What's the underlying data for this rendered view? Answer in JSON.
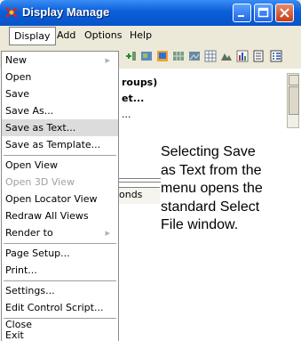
{
  "window": {
    "title": "Display Manage",
    "controls": [
      "minimize",
      "maximize",
      "close"
    ]
  },
  "menubar": {
    "items": [
      "Display",
      "Add",
      "Options",
      "Help"
    ]
  },
  "background_text": {
    "line1": "roups)",
    "line2": "et...",
    "line3": "...",
    "tab": "onds"
  },
  "display_menu": {
    "items": [
      {
        "label": "New",
        "submenu": true,
        "disabled": false
      },
      {
        "label": "Open",
        "disabled": false
      },
      {
        "label": "Save",
        "disabled": false
      },
      {
        "label": "Save As...",
        "disabled": false
      },
      {
        "label": "Save as Text...",
        "disabled": false,
        "selected": true
      },
      {
        "label": "Save as Template...",
        "disabled": false
      },
      {
        "label": "Open View",
        "disabled": false
      },
      {
        "label": "Open 3D View",
        "disabled": true
      },
      {
        "label": "Open Locator View",
        "disabled": false
      },
      {
        "label": "Redraw All Views",
        "disabled": false
      },
      {
        "label": "Render to",
        "submenu": true,
        "disabled": false
      },
      {
        "label": "Page Setup...",
        "disabled": false
      },
      {
        "label": "Print...",
        "disabled": false
      },
      {
        "label": "Settings...",
        "disabled": false
      },
      {
        "label": "Edit Control Script...",
        "disabled": false
      },
      {
        "label": "Close",
        "disabled": false
      },
      {
        "label": "Exit",
        "disabled": false
      }
    ]
  },
  "caption": {
    "lines": [
      "Selecting Save",
      "as Text from the",
      "menu opens the",
      "standard Select",
      "File window."
    ]
  },
  "colors": {
    "title_bar": "#0a5fd8",
    "menu_bg": "#ffffff",
    "selected_item": "#dcdcdc",
    "window_bg": "#ece9d8"
  }
}
